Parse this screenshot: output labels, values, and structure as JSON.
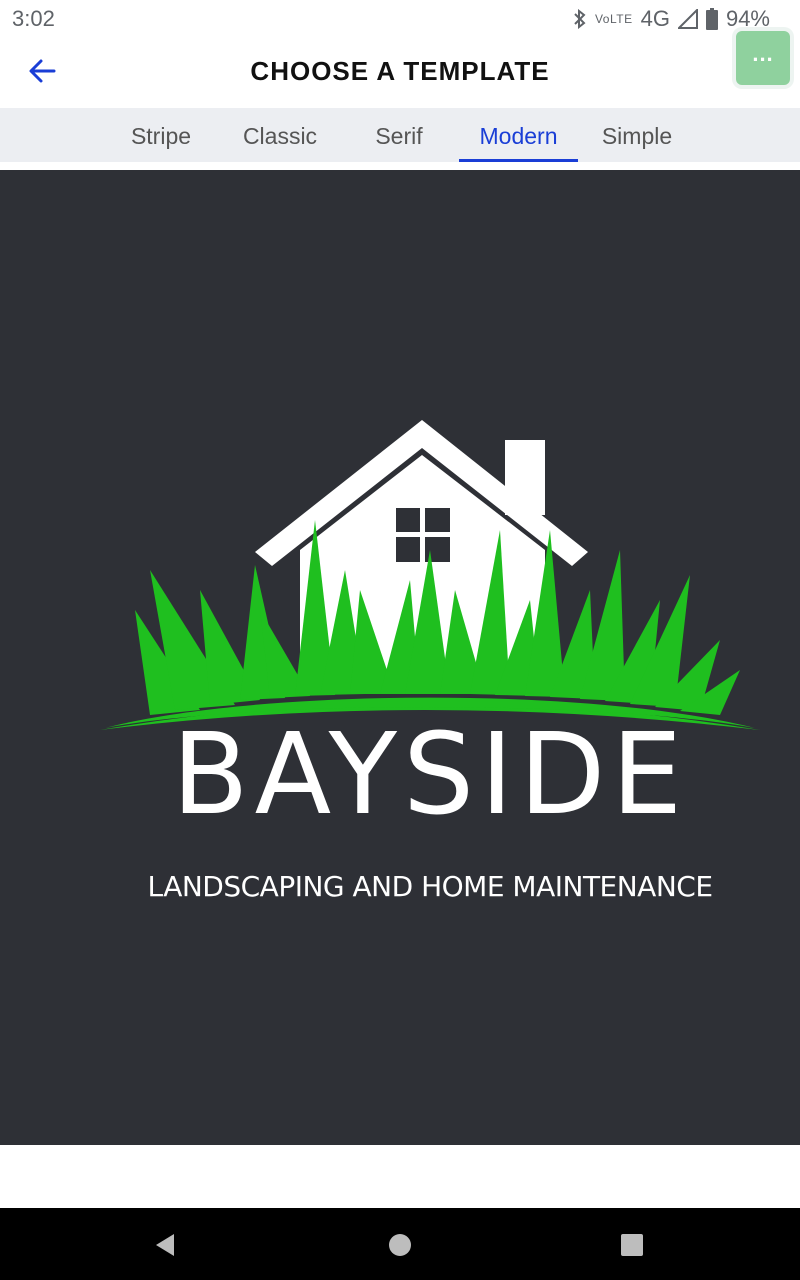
{
  "status_bar": {
    "time": "3:02",
    "volte": "VoLTE",
    "network": "4G",
    "battery": "94%",
    "icons": [
      "bluetooth-icon",
      "signal-icon",
      "battery-icon"
    ]
  },
  "header": {
    "title": "CHOOSE A TEMPLATE",
    "back_icon": "arrow-left-icon",
    "more_label": "...",
    "accent_color": "#1a3ed6",
    "more_color": "#8fd19e"
  },
  "tabs": [
    {
      "label": "Stripe",
      "active": false
    },
    {
      "label": "Classic",
      "active": false
    },
    {
      "label": "Serif",
      "active": false
    },
    {
      "label": "Modern",
      "active": true
    },
    {
      "label": "Simple",
      "active": false
    }
  ],
  "preview": {
    "brand": "BAYSIDE",
    "tagline": "LANDSCAPING AND HOME MAINTENANCE",
    "background_color": "#2e3036",
    "grass_color": "#1fbf1f"
  },
  "nav": {
    "icons": [
      "back-triangle-icon",
      "home-circle-icon",
      "recents-square-icon"
    ]
  }
}
